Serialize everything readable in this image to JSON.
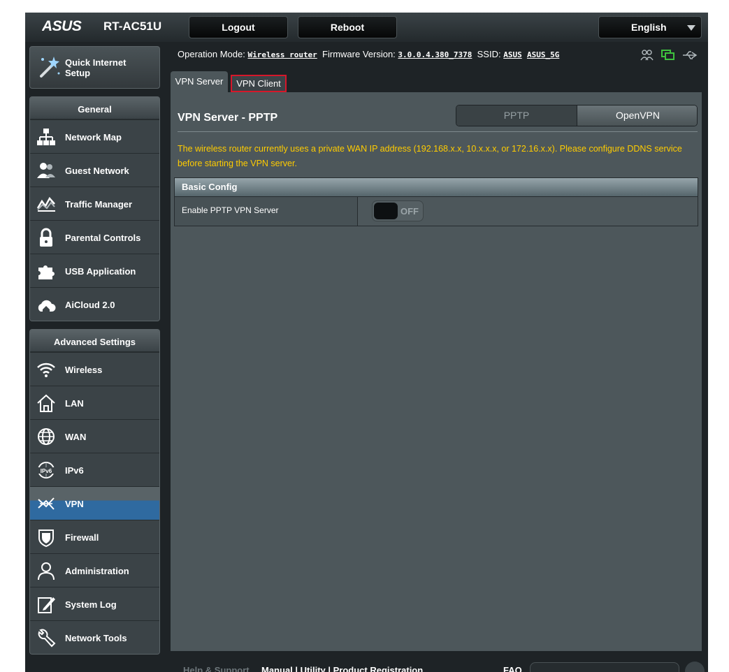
{
  "header": {
    "brand": "ASUS",
    "model": "RT-AC51U",
    "logout_label": "Logout",
    "reboot_label": "Reboot",
    "language": "English"
  },
  "sidebar": {
    "quick_setup_label": "Quick Internet Setup",
    "general": {
      "title": "General",
      "items": [
        {
          "label": "Network Map"
        },
        {
          "label": "Guest Network"
        },
        {
          "label": "Traffic Manager"
        },
        {
          "label": "Parental Controls"
        },
        {
          "label": "USB Application"
        },
        {
          "label": "AiCloud 2.0"
        }
      ]
    },
    "advanced": {
      "title": "Advanced Settings",
      "items": [
        {
          "label": "Wireless"
        },
        {
          "label": "LAN"
        },
        {
          "label": "WAN"
        },
        {
          "label": "IPv6"
        },
        {
          "label": "VPN"
        },
        {
          "label": "Firewall"
        },
        {
          "label": "Administration"
        },
        {
          "label": "System Log"
        },
        {
          "label": "Network Tools"
        }
      ]
    }
  },
  "status": {
    "operation_mode_label": "Operation Mode:",
    "operation_mode_value": "Wireless router",
    "firmware_label": "Firmware Version:",
    "firmware_value": "3.0.0.4.380_7378",
    "ssid_label": "SSID:",
    "ssid_1": "ASUS",
    "ssid_2": "ASUS_5G"
  },
  "tabs": {
    "vpn_server": "VPN Server",
    "vpn_client": "VPN Client"
  },
  "main": {
    "title": "VPN Server - PPTP",
    "mode_options": [
      "PPTP",
      "OpenVPN"
    ],
    "notice": "The wireless router currently uses a private WAN IP address (192.168.x.x, 10.x.x.x, or 172.16.x.x). Please configure DDNS service before starting the VPN server.",
    "basic_config_title": "Basic Config",
    "enable_label": "Enable PPTP VPN Server",
    "enable_state": "OFF"
  },
  "footer": {
    "help_label": "Help & Support",
    "links": "Manual | Utility | Product Registration",
    "faq_label": "FAQ"
  },
  "colors": {
    "accent_blue": "#2f6aa0",
    "notice_yellow": "#ffcc00",
    "highlight_red": "#d6172a"
  }
}
